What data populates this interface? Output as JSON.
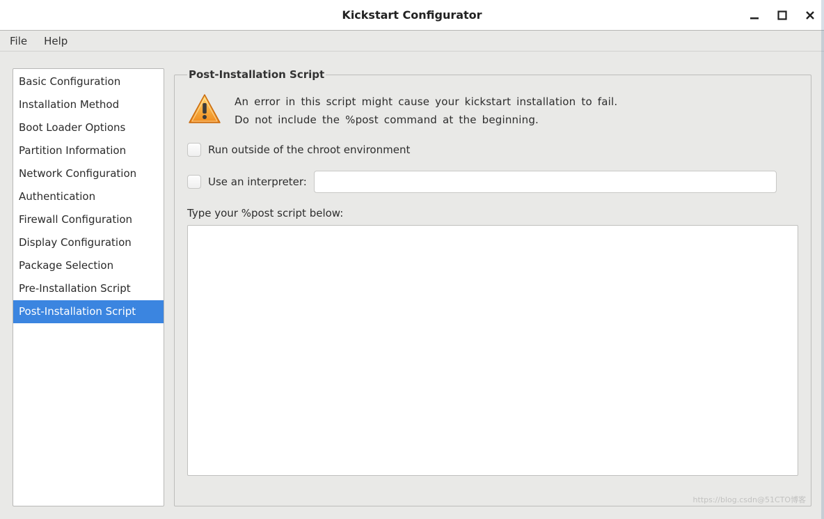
{
  "window": {
    "title": "Kickstart Configurator"
  },
  "menubar": {
    "items": [
      "File",
      "Help"
    ]
  },
  "sidebar": {
    "items": [
      "Basic Configuration",
      "Installation Method",
      "Boot Loader Options",
      "Partition Information",
      "Network Configuration",
      "Authentication",
      "Firewall Configuration",
      "Display Configuration",
      "Package Selection",
      "Pre-Installation Script",
      "Post-Installation Script"
    ],
    "selected_index": 10
  },
  "panel": {
    "legend": "Post-Installation Script",
    "warning_text": "An error in this script might cause your kickstart installation to fail. Do not include the %post command at the beginning.",
    "chroot_label": "Run outside of the chroot environment",
    "chroot_checked": false,
    "interpreter_label": "Use an interpreter:",
    "interpreter_checked": false,
    "interpreter_value": "",
    "script_prompt": "Type your %post script below:",
    "script_value": ""
  },
  "icons": {
    "warning": "warning-triangle-icon",
    "minimize": "minimize-icon",
    "maximize": "maximize-icon",
    "close": "close-icon"
  },
  "watermark": "https://blog.csdn@51CTO博客"
}
